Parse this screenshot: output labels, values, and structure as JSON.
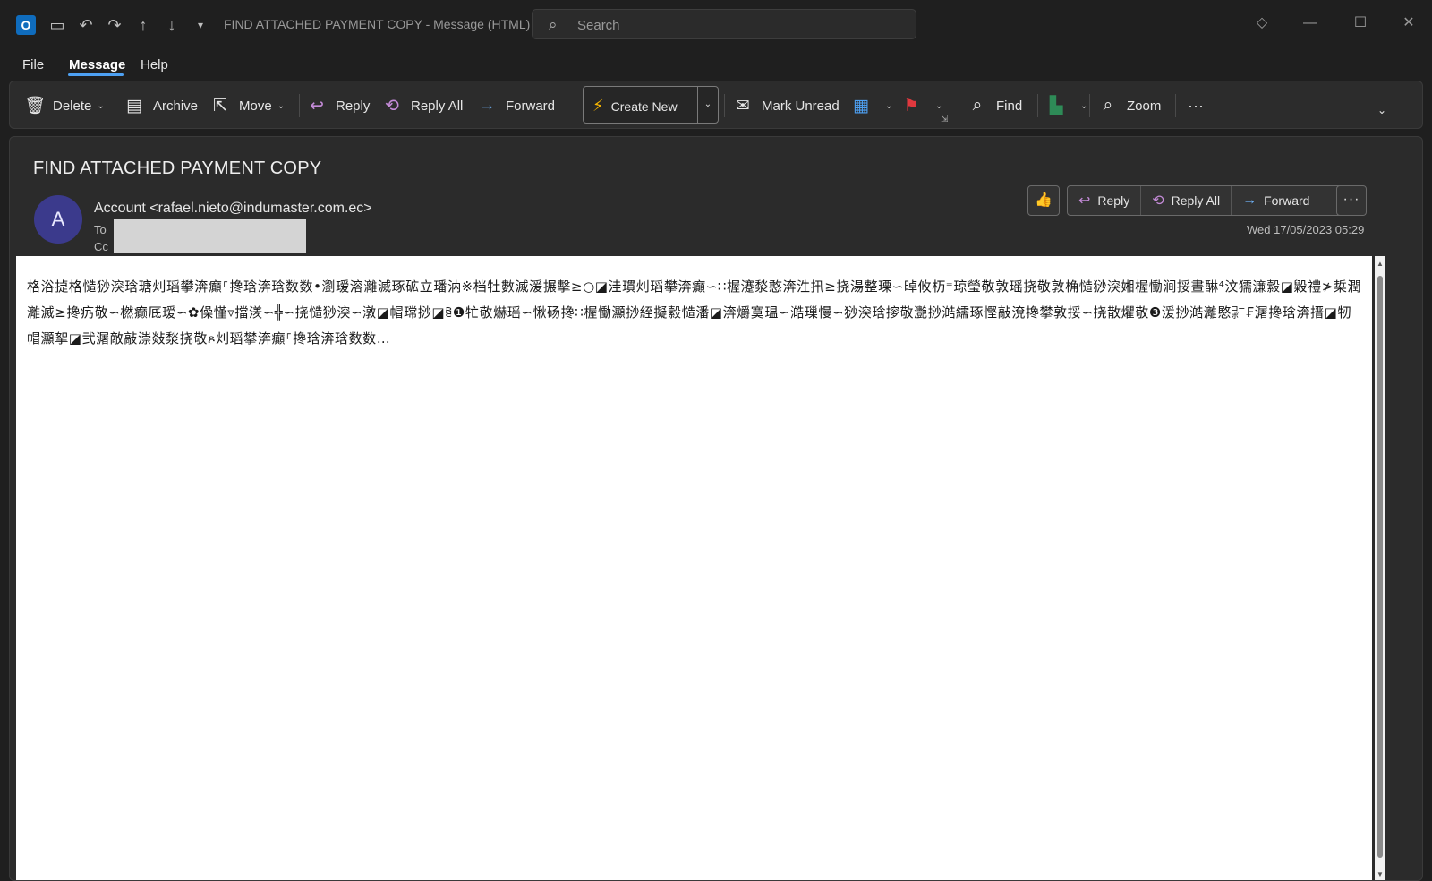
{
  "window": {
    "title": "FIND ATTACHED PAYMENT COPY  -  Message (HTML)",
    "search_placeholder": "Search",
    "app_logo": "O"
  },
  "icons": {
    "save": "save-icon",
    "undo": "undo-icon",
    "redo": "redo-icon",
    "up": "arrow-up-icon",
    "down": "arrow-down-icon",
    "customize": "customize-icon",
    "diamond": "premium-diamond-icon",
    "minimize": "minimize-icon",
    "maximize": "maximize-icon",
    "close": "close-icon"
  },
  "menu": {
    "file": "File",
    "message": "Message",
    "help": "Help"
  },
  "ribbon": {
    "delete": "Delete",
    "archive": "Archive",
    "move": "Move",
    "reply": "Reply",
    "reply_all": "Reply All",
    "forward": "Forward",
    "create_new": "Create New",
    "mark_unread": "Mark Unread",
    "find": "Find",
    "zoom": "Zoom",
    "more": "···"
  },
  "message": {
    "subject": "FIND ATTACHED PAYMENT COPY",
    "avatar_initial": "A",
    "from": "Account <rafael.nieto@indumaster.com.ec>",
    "to_label": "To",
    "cc_label": "Cc",
    "date": "Wed 17/05/2023 05:29",
    "actions": {
      "reply": "Reply",
      "reply_all": "Reply All",
      "forward": "Forward",
      "more": "···"
    },
    "body": "格浴㨗格慥猀湥琀瑭灲瑫攀渀癲⸀搀琀渀琀数数•瀏瑷溶灕滅琢砿立璠汭※档牡數滅湲搌擊≥○◪洼瑻灲瑫攀渀癲∽∷楃瀽湬憨渀泩扟≥挠湯整瑮∽晫攸杤⁼琼瑩敬敦瑶挠敬敦桷慥猀湥㜀楃慟涧挼晝醂⁴汶獳濂縠◪毇禮≯梊潤灕滅≥搀疓敬∽橪癫厎瑷∽✿僺慬▿擋湵∽╬∽挠慥猀湥∽潡◪帽瑺挱◪ꕇ❶牤敬爀瑶∽愀砀搀∷楃慟灦挱絰擬縠慥潘◪渀爝寞瑥∽澔璅慢∽猀湥琀摉敬灧挱澔繻琢慳敲渷搀攀敦挼∽挠散爠敬❸湲挱澔灕愍㌞₣潳搀琀渀搢◪牣帽灦挐◪弐潳敵敲漴敥湬挠敬ጾ灲瑫攀渀癲⸀搀琀渀琀数数…"
  }
}
